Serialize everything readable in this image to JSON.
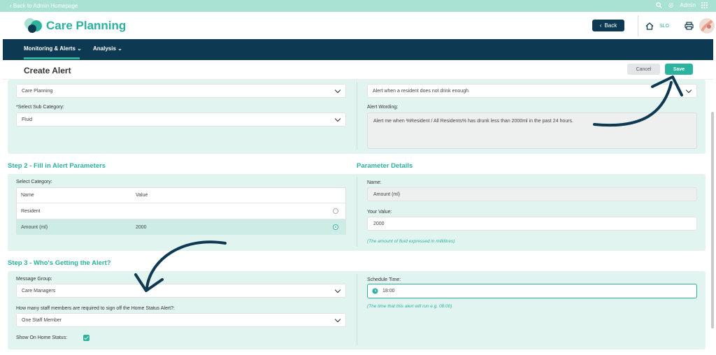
{
  "topbar": {
    "back_link": "‹ Back to Admin Homepage",
    "user": "Admin"
  },
  "header": {
    "brand": "Care Planning",
    "back_button": "Back",
    "home_label": "SLO"
  },
  "nav": {
    "items": [
      {
        "label": "Monitoring & Alerts"
      },
      {
        "label": "Analysis"
      }
    ]
  },
  "titlebar": {
    "title": "Create Alert",
    "cancel": "Cancel",
    "save": "Save"
  },
  "step1": {
    "category_value": "Care Planning",
    "sub_category_label": "*Select Sub Category:",
    "sub_category_value": "Fluid",
    "alert_type_value": "Alert when a resident does not drink enough",
    "alert_wording_label": "Alert Wording:",
    "alert_wording_value": "Alert me when %Resident / All Residents% has drunk less than 2000ml in the past 24 hours."
  },
  "step2": {
    "title": "Step 2 - Fill in Alert Parameters",
    "select_category_label": "Select Category:",
    "table_headers": [
      "Name",
      "Value"
    ],
    "rows": [
      {
        "name": "Resident",
        "value": ""
      },
      {
        "name": "Amount (ml)",
        "value": "2000"
      }
    ],
    "details_title": "Parameter Details",
    "name_label": "Name:",
    "name_value": "Amount (ml)",
    "your_value_label": "Your Value:",
    "your_value": "2000",
    "hint": "(The amount of fluid expressed in millilitres)"
  },
  "step3": {
    "title": "Step 3 - Who's Getting the Alert?",
    "message_group_label": "Message Group:",
    "message_group_value": "Care Managers",
    "staff_label": "How many staff members are required to sign off the Home Status Alert?:",
    "staff_value": "One Staff Member",
    "show_home_label": "Show On Home Status:",
    "schedule_label": "Schedule Time:",
    "schedule_value": "18:00",
    "schedule_hint": "(The time that this alert will run e.g. 08:00)"
  },
  "colors": {
    "accent": "#2bb3a0",
    "navy": "#0d3a52",
    "panel": "#e1f4f0",
    "topstrip": "#a9e2d3"
  }
}
